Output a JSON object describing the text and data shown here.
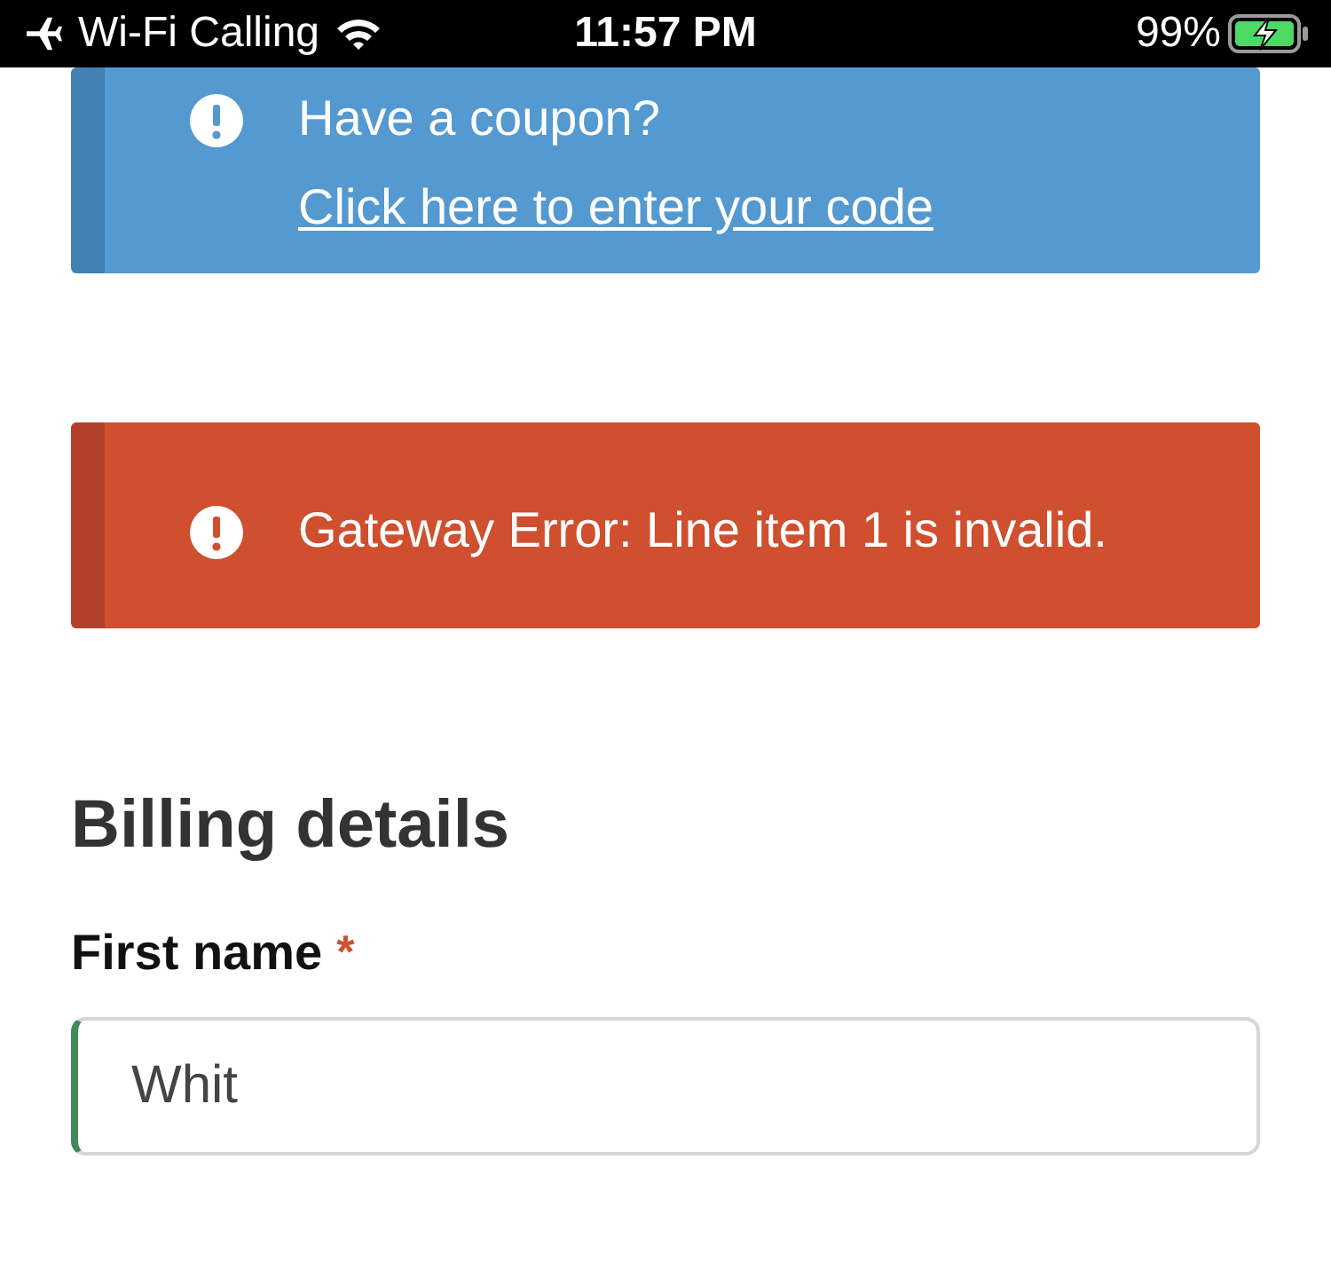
{
  "status_bar": {
    "carrier": "Wi-Fi Calling",
    "time": "11:57 PM",
    "battery": "99%"
  },
  "notices": [
    {
      "kind": "info",
      "text": "Have a coupon?",
      "link": "Click here to enter your code"
    },
    {
      "kind": "error",
      "text": "Gateway Error: Line item 1 is invalid."
    }
  ],
  "billing": {
    "heading": "Billing details",
    "fields": [
      {
        "label": "First name",
        "required_mark": "*",
        "value": "Whit",
        "valid": true
      }
    ]
  }
}
